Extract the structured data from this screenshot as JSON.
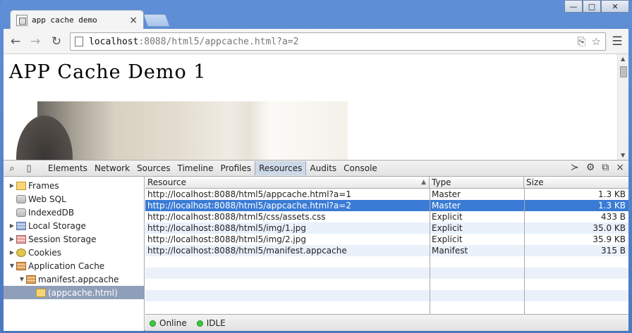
{
  "browser": {
    "tab_title": "app cache demo",
    "tab_close": "×",
    "url_host": "localhost",
    "url_path": ":8088/html5/appcache.html?a=2",
    "window_controls": {
      "minimize": "—",
      "maximize": "□",
      "close": "✕"
    }
  },
  "page": {
    "heading": "APP Cache Demo 1"
  },
  "devtools": {
    "tabs": [
      "Elements",
      "Network",
      "Sources",
      "Timeline",
      "Profiles",
      "Resources",
      "Audits",
      "Console"
    ],
    "active_tab": "Resources",
    "sidebar": [
      {
        "label": "Frames",
        "icon": "folder-icon",
        "arrow": "▶",
        "indent": 0
      },
      {
        "label": "Web SQL",
        "icon": "database-icon",
        "arrow": "",
        "indent": 0
      },
      {
        "label": "IndexedDB",
        "icon": "database-icon",
        "arrow": "",
        "indent": 0
      },
      {
        "label": "Local Storage",
        "icon": "storage-grid-icon",
        "arrow": "▶",
        "indent": 0
      },
      {
        "label": "Session Storage",
        "icon": "session-grid-icon",
        "arrow": "▶",
        "indent": 0
      },
      {
        "label": "Cookies",
        "icon": "cookie-icon",
        "arrow": "▶",
        "indent": 0
      },
      {
        "label": "Application Cache",
        "icon": "appcache-grid-icon",
        "arrow": "▼",
        "indent": 0
      },
      {
        "label": "manifest.appcache",
        "icon": "appcache-grid-icon",
        "arrow": "▼",
        "indent": 1
      },
      {
        "label": "(appcache.html)",
        "icon": "folder-icon",
        "arrow": "",
        "indent": 2,
        "selected": true
      }
    ],
    "columns": {
      "resource": "Resource",
      "type": "Type",
      "size": "Size"
    },
    "rows": [
      {
        "resource": "http://localhost:8088/html5/appcache.html?a=1",
        "type": "Master",
        "size": "1.3 KB"
      },
      {
        "resource": "http://localhost:8088/html5/appcache.html?a=2",
        "type": "Master",
        "size": "1.3 KB",
        "selected": true
      },
      {
        "resource": "http://localhost:8088/html5/css/assets.css",
        "type": "Explicit",
        "size": "433 B"
      },
      {
        "resource": "http://localhost:8088/html5/img/1.jpg",
        "type": "Explicit",
        "size": "35.0 KB"
      },
      {
        "resource": "http://localhost:8088/html5/img/2.jpg",
        "type": "Explicit",
        "size": "35.9 KB"
      },
      {
        "resource": "http://localhost:8088/html5/manifest.appcache",
        "type": "Manifest",
        "size": "315 B"
      }
    ],
    "status": {
      "online": "Online",
      "state": "IDLE"
    }
  }
}
